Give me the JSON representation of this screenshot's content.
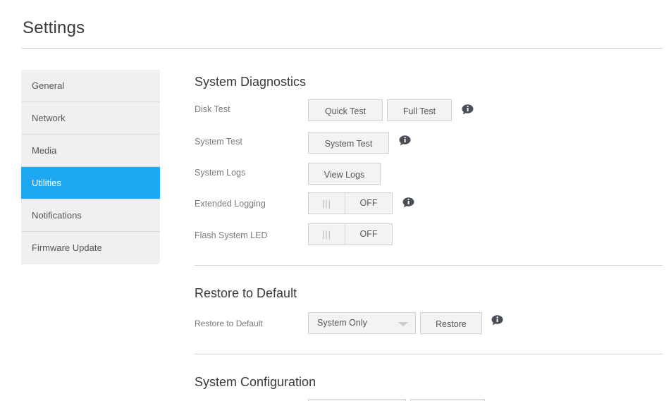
{
  "page": {
    "title": "Settings"
  },
  "sidebar": {
    "items": [
      {
        "label": "General",
        "active": false
      },
      {
        "label": "Network",
        "active": false
      },
      {
        "label": "Media",
        "active": false
      },
      {
        "label": "Utilities",
        "active": true
      },
      {
        "label": "Notifications",
        "active": false
      },
      {
        "label": "Firmware Update",
        "active": false
      }
    ]
  },
  "diagnostics": {
    "title": "System Diagnostics",
    "disk_test": {
      "label": "Disk Test",
      "quick_test_label": "Quick Test",
      "full_test_label": "Full Test"
    },
    "system_test": {
      "label": "System Test",
      "button_label": "System Test"
    },
    "system_logs": {
      "label": "System Logs",
      "button_label": "View Logs"
    },
    "extended_logging": {
      "label": "Extended Logging",
      "handle_glyph": "|||",
      "state": "OFF"
    },
    "flash_led": {
      "label": "Flash System LED",
      "handle_glyph": "|||",
      "state": "OFF"
    }
  },
  "restore": {
    "title": "Restore to Default",
    "label": "Restore to Default",
    "select_value": "System Only",
    "button_label": "Restore"
  },
  "configuration": {
    "title": "System Configuration"
  },
  "colors": {
    "accent": "#1ea8f1",
    "info_icon": "#4a4f57"
  },
  "icons": {
    "info": "info-icon",
    "dropdown": "chevron-down-icon"
  }
}
